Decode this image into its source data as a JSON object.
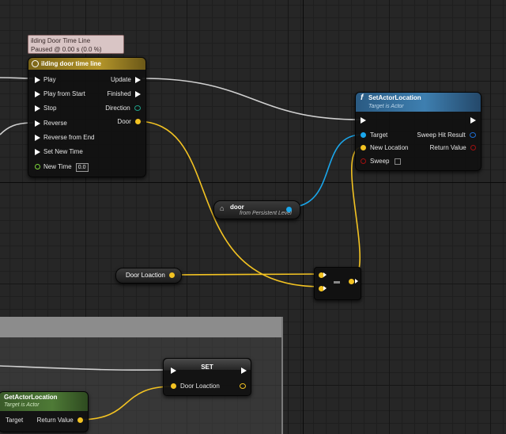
{
  "tooltip": {
    "line1": "ilding Door Time Line",
    "line2": "Paused @ 0.00 s (0.0 %)"
  },
  "timeline": {
    "title": "ilding door time line",
    "inputs": [
      "Play",
      "Play from Start",
      "Stop",
      "Reverse",
      "Reverse from End",
      "Set New Time",
      "New Time"
    ],
    "new_time_value": "0.0",
    "outputs": [
      "Update",
      "Finished",
      "Direction",
      "Door"
    ]
  },
  "set_actor_location": {
    "title": "SetActorLocation",
    "subtitle": "Target is Actor",
    "inputs": [
      "Target",
      "New Location",
      "Sweep"
    ],
    "outputs": [
      "Sweep Hit Result",
      "Return Value"
    ]
  },
  "door_ref": {
    "title": "door",
    "subtitle": "from Persistent Level"
  },
  "door_loaction_var": {
    "label": "Door Loaction"
  },
  "set_node": {
    "title": "SET",
    "pin_label": "Door Loaction"
  },
  "get_actor_location": {
    "title": "GetActorLocation",
    "subtitle": "Target is Actor",
    "input": "Target",
    "output": "Return Value"
  },
  "colors": {
    "vector": "#f3c322",
    "object": "#1aa7ec",
    "struct": "#1e6fd6",
    "bool": "#8b0000",
    "float": "#7cd63a",
    "exec": "#ffffff",
    "wire_exec": "#cfcfcf"
  }
}
